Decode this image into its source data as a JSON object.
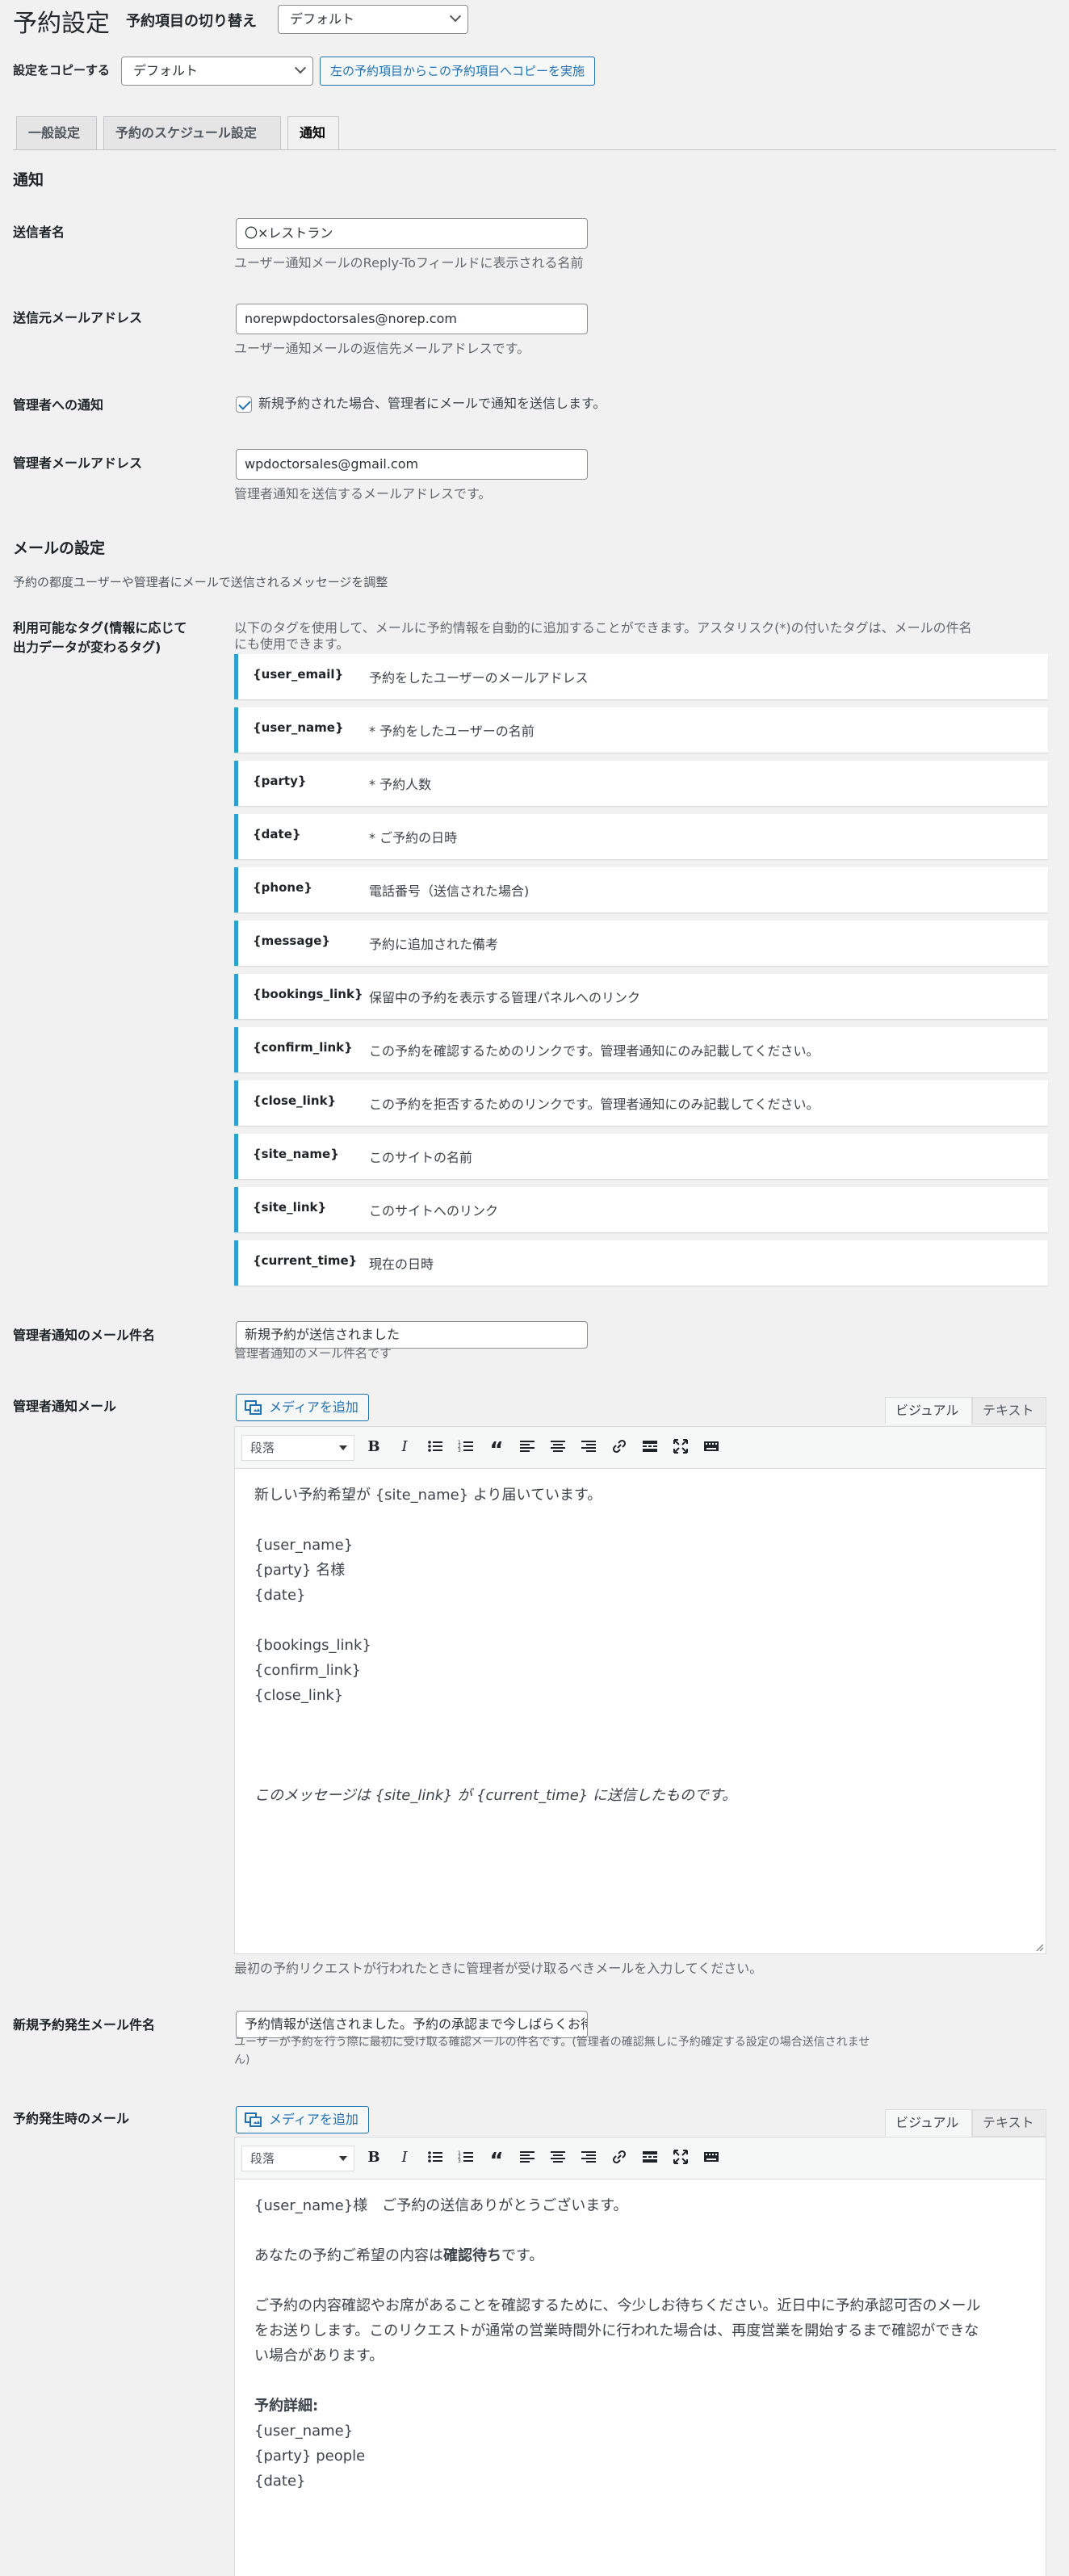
{
  "header": {
    "title": "予約設定",
    "switch_label": "予約項目の切り替え",
    "switch_value": "デフォルト",
    "copy_label": "設定をコピーする",
    "copy_value": "デフォルト",
    "copy_button": "左の予約項目からこの予約項目へコピーを実施"
  },
  "tabs": [
    {
      "label": "一般設定"
    },
    {
      "label": "予約のスケジュール設定"
    },
    {
      "label": "通知"
    }
  ],
  "notification": {
    "heading": "通知",
    "sender_name_label": "送信者名",
    "sender_name_value": "〇×レストラン",
    "sender_name_desc": "ユーザー通知メールのReply-Toフィールドに表示される名前",
    "sender_email_label": "送信元メールアドレス",
    "sender_email_value": "norepwpdoctorsales@norep.com",
    "sender_email_desc": "ユーザー通知メールの返信先メールアドレスです。",
    "admin_notify_label": "管理者への通知",
    "admin_notify_text": "新規予約された場合、管理者にメールで通知を送信します。",
    "admin_notify_checked": true,
    "admin_email_label": "管理者メールアドレス",
    "admin_email_value": "wpdoctorsales@gmail.com",
    "admin_email_desc": "管理者通知を送信するメールアドレスです。"
  },
  "mail_settings": {
    "heading": "メールの設定",
    "desc": "予約の都度ユーザーや管理者にメールで送信されるメッセージを調整",
    "tags_label_1": "利用可能なタグ(情報に応じて",
    "tags_label_2": "出力データが変わるタグ)",
    "tags_desc_1": "以下のタグを使用して、メールに予約情報を自動的に追加することができます。アスタリスク(*)の付いたタグは、メールの件名",
    "tags_desc_2": "にも使用できます。",
    "tags": [
      {
        "tag": "{user_email}",
        "desc": "予約をしたユーザーのメールアドレス"
      },
      {
        "tag": "{user_name}",
        "desc": "* 予約をしたユーザーの名前"
      },
      {
        "tag": "{party}",
        "desc": "* 予約人数"
      },
      {
        "tag": "{date}",
        "desc": "* ご予約の日時"
      },
      {
        "tag": "{phone}",
        "desc": "電話番号（送信された場合)"
      },
      {
        "tag": "{message}",
        "desc": "予約に追加された備考"
      },
      {
        "tag": "{bookings_link}",
        "desc": "保留中の予約を表示する管理パネルへのリンク"
      },
      {
        "tag": "{confirm_link}",
        "desc": "この予約を確認するためのリンクです。管理者通知にのみ記載してください。"
      },
      {
        "tag": "{close_link}",
        "desc": "この予約を拒否するためのリンクです。管理者通知にのみ記載してください。"
      },
      {
        "tag": "{site_name}",
        "desc": "このサイトの名前"
      },
      {
        "tag": "{site_link}",
        "desc": "このサイトへのリンク"
      },
      {
        "tag": "{current_time}",
        "desc": "現在の日時"
      }
    ]
  },
  "admin_subject": {
    "label": "管理者通知のメール件名",
    "value": "新規予約が送信されました",
    "desc": "管理者通知のメール件名です"
  },
  "admin_mail": {
    "label": "管理者通知メール",
    "media_button": "メディアを追加",
    "tab_visual": "ビジュアル",
    "tab_text": "テキスト",
    "format": "段落",
    "lines": [
      "新しい予約希望が {site_name} より届いています。",
      "{user_name}",
      "{party} 名様",
      "{date}",
      "{bookings_link}",
      "{confirm_link}",
      "{close_link}",
      "このメッセージは {site_link} が {current_time} に送信したものです。"
    ],
    "desc": "最初の予約リクエストが行われたときに管理者が受け取るべきメールを入力してください。"
  },
  "new_booking_subject": {
    "label": "新規予約発生メール件名",
    "value": "予約情報が送信されました。予約の承認まで今しばらくお待ちください。",
    "desc_1": "ユーザーが予約を行う際に最初に受け取る確認メールの件名です。(管理者の確認無しに予約確定する設定の場合送信されませ",
    "desc_2": "ん)"
  },
  "booking_mail": {
    "label": "予約発生時のメール",
    "media_button": "メディアを追加",
    "tab_visual": "ビジュアル",
    "tab_text": "テキスト",
    "format": "段落",
    "line1": "{user_name}様　ご予約の送信ありがとうございます。",
    "line2_pre": "あなたの予約ご希望の内容は",
    "line2_bold": "確認待ち",
    "line2_post": "です。",
    "line3a": "ご予約の内容確認やお席があることを確認するために、今少しお待ちください。近日中に予約承認可否のメール",
    "line3b": "をお送りします。このリクエストが通常の営業時間外に行われた場合は、再度営業を開始するまで確認ができな",
    "line3c": "い場合があります。",
    "details_heading": "予約詳細:",
    "d1": "{user_name}",
    "d2": "{party} people",
    "d3": "{date}"
  },
  "colors": {
    "accent": "#2271b1",
    "tag_border": "#2ea2cc",
    "background": "#f1f1f1"
  }
}
